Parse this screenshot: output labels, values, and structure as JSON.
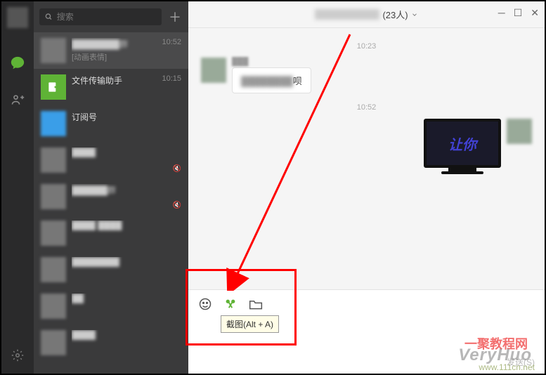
{
  "search": {
    "placeholder": "搜索"
  },
  "conversations": [
    {
      "title": "████████群",
      "sub": "[动画表情]",
      "time": "10:52",
      "blurred": true
    },
    {
      "title": "文件传输助手",
      "time": "10:15",
      "avatar": "green"
    },
    {
      "title": "订阅号",
      "avatar": "blue"
    },
    {
      "title": "████",
      "muted": true,
      "blurred": true
    },
    {
      "title": "██████群",
      "muted": true,
      "blurred": true
    },
    {
      "title": "████ ████",
      "blurred": true
    },
    {
      "title": "████████",
      "blurred": true
    },
    {
      "title": "██",
      "blurred": true
    },
    {
      "title": "████",
      "blurred": true
    }
  ],
  "header": {
    "title_suffix": "(23人)"
  },
  "timestamps": {
    "t1": "10:23",
    "t2": "10:52"
  },
  "msg1": {
    "name": "███",
    "text_suffix": "呗"
  },
  "image_msg": {
    "caption": "让你"
  },
  "tooltip": {
    "text": "截图(Alt + A)"
  },
  "send_hint": "发送(S)",
  "watermark": {
    "logo": "VeryHuo",
    "url": "www.111cn.net",
    "cn": "一聚教程网"
  },
  "icons": {
    "chat": "chat-bubble-icon",
    "contacts": "contacts-icon",
    "settings": "gear-icon",
    "search": "search-icon",
    "plus": "plus-icon",
    "emoji": "emoji-icon",
    "scissors": "scissors-icon",
    "folder": "folder-icon",
    "chevron": "chevron-down-icon",
    "minimize": "minimize-icon",
    "maximize": "maximize-icon",
    "close": "close-icon",
    "mute": "mute-icon"
  }
}
